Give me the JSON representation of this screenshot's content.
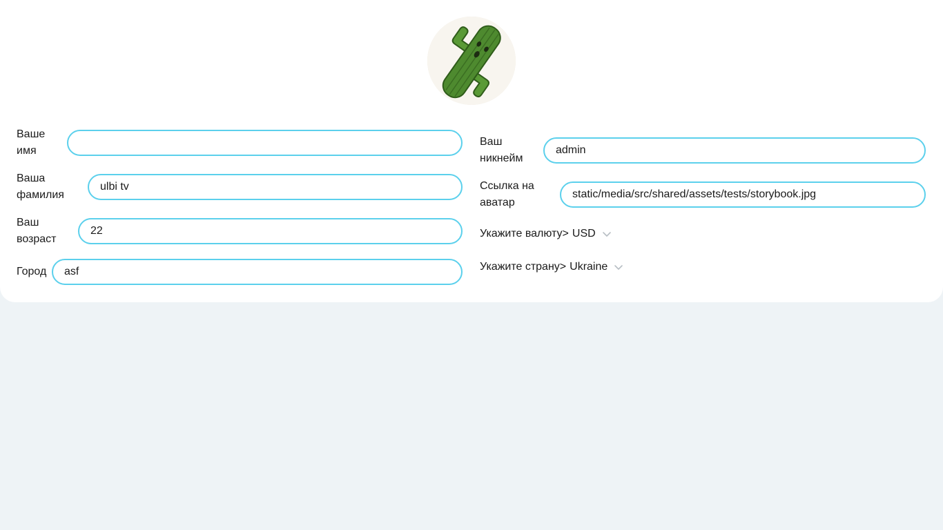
{
  "profile": {
    "avatar_alt": "avatar",
    "fields": {
      "first_name": {
        "label": "Ваше имя",
        "value": ""
      },
      "last_name": {
        "label": "Ваша фамилия",
        "value": "ulbi tv"
      },
      "age": {
        "label": "Ваш возраст",
        "value": "22"
      },
      "city": {
        "label": "Город",
        "value": "asf"
      },
      "username": {
        "label": "Ваш никнейм",
        "value": "admin"
      },
      "avatar_link": {
        "label": "Ссылка на аватар",
        "value": "static/media/src/shared/assets/tests/storybook.jpg"
      }
    },
    "currency": {
      "label": "Укажите валюту>",
      "value": "USD"
    },
    "country": {
      "label": "Укажите страну>",
      "value": "Ukraine"
    }
  },
  "icons": {
    "chevron": "chevron-down-icon",
    "avatar_image": "cactus-avatar"
  }
}
